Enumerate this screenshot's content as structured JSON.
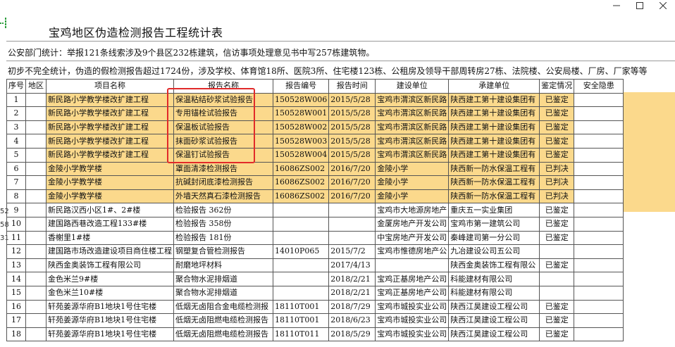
{
  "window": {
    "controls": [
      "minimize",
      "maximize",
      "close"
    ]
  },
  "doc": {
    "title": "宝鸡地区伪造检测报告工程统计表",
    "note1": "公安部门统计：举报121条线索涉及9个县区232栋建筑，信访事项处理意见书中写257栋建筑物。",
    "note2": "初步不完全统计，伪造的假检测报告超过1724份，涉及学校、体育馆18所、医院3所、住宅楼123栋、公租房及领导干部周转房27栋、法院楼、公安局楼、厂房、厂家等等"
  },
  "left_sliver": [
    "52",
    "58",
    "31"
  ],
  "table": {
    "headers": [
      "序号",
      "地区",
      "项目名称",
      "报告名称",
      "报告编号",
      "报告时间",
      "建设单位",
      "承建单位",
      "鉴定情况",
      "安全隐患"
    ],
    "rows": [
      {
        "no": "1",
        "area": "",
        "project": "新民路小学教学楼改扩建工程",
        "report": "保温粘结砂浆试验报告",
        "code": "150528W006",
        "date": "2015/5/28",
        "builder": "宝鸡市渭滨区新民路",
        "contractor": "陕西建工第十建设集团有",
        "status": "已鉴定",
        "risk": "",
        "hl": true
      },
      {
        "no": "2",
        "area": "",
        "project": "新民路小学教学楼改扩建工程",
        "report": "专用锚栓试验报告",
        "code": "150528W001",
        "date": "2015/5/28",
        "builder": "宝鸡市渭滨区新民路",
        "contractor": "陕西建工第十建设集团有",
        "status": "已鉴定",
        "risk": "",
        "hl": true
      },
      {
        "no": "3",
        "area": "",
        "project": "新民路小学教学楼改扩建工程",
        "report": "保温板试验报告",
        "code": "150528W002",
        "date": "2015/5/28",
        "builder": "宝鸡市渭滨区新民路",
        "contractor": "陕西建工第十建设集团有",
        "status": "已鉴定",
        "risk": "",
        "hl": true
      },
      {
        "no": "4",
        "area": "",
        "project": "新民路小学教学楼改扩建工程",
        "report": "抹面砂浆试验报告",
        "code": "150528W003",
        "date": "2015/5/28",
        "builder": "宝鸡市渭滨区新民路",
        "contractor": "陕西建工第十建设集团有",
        "status": "已鉴定",
        "risk": "",
        "hl": true
      },
      {
        "no": "5",
        "area": "",
        "project": "新民路小学教学楼改扩建工程",
        "report": "保温钉试验报告",
        "code": "150528W004",
        "date": "2015/5/28",
        "builder": "宝鸡市渭滨区新民路",
        "contractor": "陕西建工第十建设集团有",
        "status": "已鉴定",
        "risk": "",
        "hl": true
      },
      {
        "no": "6",
        "area": "",
        "project": "金陵小学教学楼",
        "report": "罩面清漆检测报告",
        "code": "16086ZS002",
        "date": "2016/7/20",
        "builder": "金陵小学",
        "contractor": "陕西新一防水保温工程有",
        "status": "已判决",
        "risk": "",
        "hl": true
      },
      {
        "no": "7",
        "area": "",
        "project": "金陵小学教学楼",
        "report": "抗碱封闭底漆检测报告",
        "code": "16086ZS002",
        "date": "2016/7/20",
        "builder": "金陵小学",
        "contractor": "陕西新一防水保温工程有",
        "status": "已判决",
        "risk": "",
        "hl": true
      },
      {
        "no": "8",
        "area": "",
        "project": "金陵小学教学楼",
        "report": "外墙天然真石漆检测报告",
        "code": "16086ZS002",
        "date": "2016/7/20",
        "builder": "金陵小学",
        "contractor": "陕西新一防水保温工程有",
        "status": "已判决",
        "risk": "",
        "hl": true
      },
      {
        "no": "9",
        "area": "",
        "project": "新民路汉西小区1#、2#楼",
        "report": "检验报告 362份",
        "code": "",
        "date": "",
        "builder": "宝鸡市大地源房地产",
        "contractor": "重庆五一实业集团",
        "status": "已鉴定",
        "risk": "",
        "hl": false
      },
      {
        "no": "10",
        "area": "",
        "project": "建国路西巷改造工程133#楼",
        "report": "检验报告 358份",
        "code": "",
        "date": "",
        "builder": "金厦房地产开发公司",
        "contractor": "宝鸡市第一建筑公司",
        "status": "已鉴定",
        "risk": "",
        "hl": false
      },
      {
        "no": "11",
        "area": "",
        "project": "香榭里1#楼",
        "report": "检验报告 181份",
        "code": "",
        "date": "",
        "builder": "中宝房地产开发公司",
        "contractor": "秦峰建司第一分公司",
        "status": "已鉴定",
        "risk": "",
        "hl": false
      },
      {
        "no": "12",
        "area": "",
        "project": "建国路市场改造建设项目商住楼工程",
        "report": "钢塑复合管检测报告",
        "code": "14010P065",
        "date": "2015/7/2",
        "builder": "宝鸡市惟德房地产公",
        "contractor": "九冶建设公司五公司",
        "status": "",
        "risk": "",
        "hl": false
      },
      {
        "no": "13",
        "area": "",
        "project": "陕西金奥装饰工程有限公司",
        "report": "耐磨地坪材料",
        "code": "",
        "date": "2017/4/13",
        "builder": "",
        "contractor": "陕西金奥装饰工程有限公",
        "status": "已鉴定",
        "risk": "",
        "hl": false
      },
      {
        "no": "14",
        "area": "",
        "project": "金色米兰9#楼",
        "report": "聚合物水泥排烟道",
        "code": "",
        "date": "2018/2/21",
        "builder": "宝鸡正基房地产公司",
        "contractor": "科能建材有限公司",
        "status": "",
        "risk": "",
        "hl": false
      },
      {
        "no": "15",
        "area": "",
        "project": "金色米兰10#楼",
        "report": "聚合物水泥排烟道",
        "code": "",
        "date": "2018/2/21",
        "builder": "宝鸡正基房地产公司",
        "contractor": "科能建材有限公司",
        "status": "",
        "risk": "",
        "hl": false
      },
      {
        "no": "16",
        "area": "",
        "project": "轩苑姜源华府B1地块1号住宅楼",
        "report": "低烟无卤阻合金电缆检测报",
        "code": "18110T001",
        "date": "2018/7/29",
        "builder": "宝鸡市城投实业公司",
        "contractor": "陕西江昊建设工程公司",
        "status": "已鉴定",
        "risk": "",
        "hl": false
      },
      {
        "no": "17",
        "area": "",
        "project": "轩苑姜源华府B1地块1号住宅楼",
        "report": "低烟无卤阻燃电缆检测报告",
        "code": "18110T001",
        "date": "2018/6/23",
        "builder": "宝鸡市城投实业公司",
        "contractor": "陕西江昊建设工程公司",
        "status": "已鉴定",
        "risk": "",
        "hl": false
      },
      {
        "no": "18",
        "area": "",
        "project": "轩苑姜源华府B1地块1号住宅楼",
        "report": "低烟无卤阻燃电缆检测报告",
        "code": "18110T011",
        "date": "2018/5/29",
        "builder": "宝鸡市城投实业公司",
        "contractor": "陕西江昊建设工程公司",
        "status": "已鉴定",
        "risk": "",
        "hl": false
      }
    ]
  },
  "colors": {
    "highlight": "#fbd98c",
    "annotation_box": "#e12a2a"
  }
}
